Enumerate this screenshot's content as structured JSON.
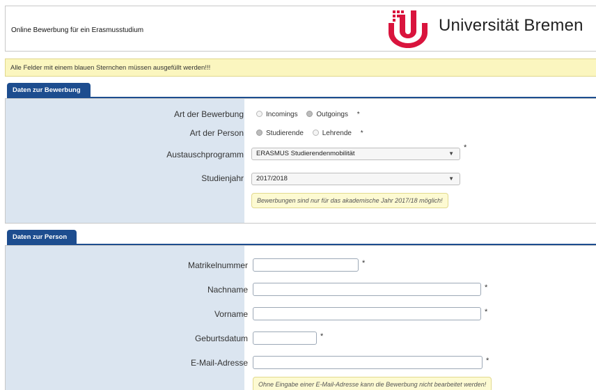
{
  "header": {
    "title": "Online Bewerbung für ein Erasmusstudium",
    "university": "Universität Bremen"
  },
  "notice": "Alle Felder mit einem blauen Sternchen müssen ausgefüllt werden!!!",
  "colors": {
    "tab": "#1d4d8f",
    "label_bg": "#dbe5f0",
    "notice_bg": "#fbf6bf",
    "logo": "#d9143d"
  },
  "required_marker": "*",
  "section1": {
    "tab": "Daten zur Bewerbung",
    "art_bewerbung": {
      "label": "Art der Bewerbung",
      "options": [
        "Incomings",
        "Outgoings"
      ],
      "selected": "Outgoings"
    },
    "art_person": {
      "label": "Art der Person",
      "options": [
        "Studierende",
        "Lehrende"
      ],
      "selected": "Studierende"
    },
    "austauschprogramm": {
      "label": "Austauschprogramm",
      "value": "ERASMUS Studierendenmobilität"
    },
    "studienjahr": {
      "label": "Studienjahr",
      "value": "2017/2018"
    },
    "hint": "Bewerbungen sind nur für das akademische Jahr 2017/18 möglich!"
  },
  "section2": {
    "tab": "Daten zur Person",
    "matrikelnummer": {
      "label": "Matrikelnummer",
      "value": ""
    },
    "nachname": {
      "label": "Nachname",
      "value": ""
    },
    "vorname": {
      "label": "Vorname",
      "value": ""
    },
    "geburtsdatum": {
      "label": "Geburtsdatum",
      "value": ""
    },
    "email": {
      "label": "E-Mail-Adresse",
      "value": ""
    },
    "hint": "Ohne Eingabe einer E-Mail-Adresse kann die Bewerbung nicht bearbeitet werden!"
  }
}
